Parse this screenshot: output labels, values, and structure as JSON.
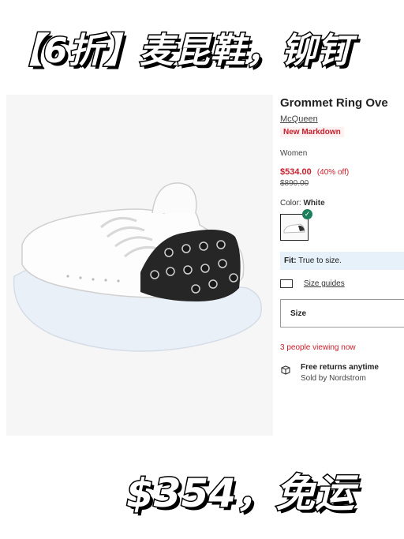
{
  "banner": {
    "top": "【6折】麦昆鞋，铆钉",
    "bottom": "$354，免运"
  },
  "product": {
    "title": "Grommet Ring Ove",
    "brand": "McQueen",
    "badge": "New Markdown",
    "gender": "Women",
    "price": "$534.00",
    "discount": "(40% off)",
    "original_price": "$890.00",
    "color_label": "Color:",
    "color_value": "White",
    "fit_label": "Fit:",
    "fit_value": "True to size.",
    "size_guides": "Size guides",
    "size_placeholder": "Size",
    "viewing_count": "3",
    "viewing_text": " people viewing now",
    "returns_title": "Free returns anytime",
    "sold_by": "Sold by Nordstrom"
  },
  "colors": {
    "accent_red": "#c8202d",
    "check_green": "#1a7f5a",
    "fit_bg": "#e6f1fa"
  }
}
